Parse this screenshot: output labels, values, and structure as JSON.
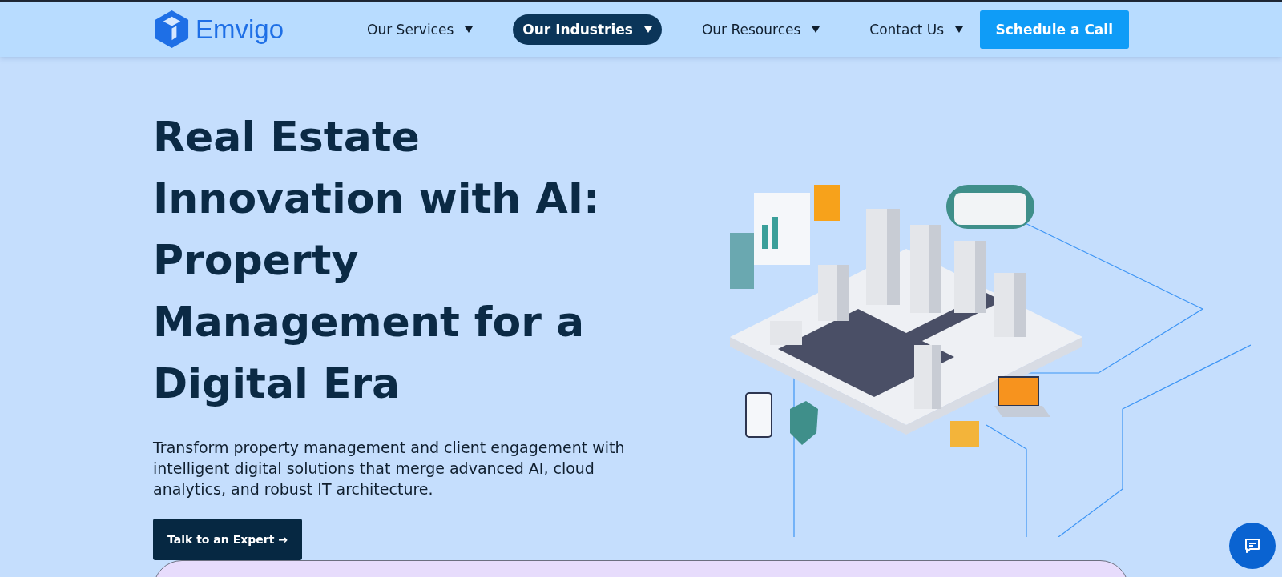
{
  "header": {
    "logo_text": "Emvigo",
    "nav": [
      {
        "label": "Our Services",
        "selected": false
      },
      {
        "label": "Our Industries",
        "selected": true
      },
      {
        "label": "Our Resources",
        "selected": false
      },
      {
        "label": "Contact Us",
        "selected": false
      }
    ],
    "cta": "Schedule a Call"
  },
  "hero": {
    "title": "Real Estate Innovation with AI: Property Management for a Digital Era",
    "description": "Transform property management and client engagement with intelligent digital solutions that merge advanced AI, cloud analytics, and robust IT architecture.",
    "button": "Talk to an Expert →"
  }
}
